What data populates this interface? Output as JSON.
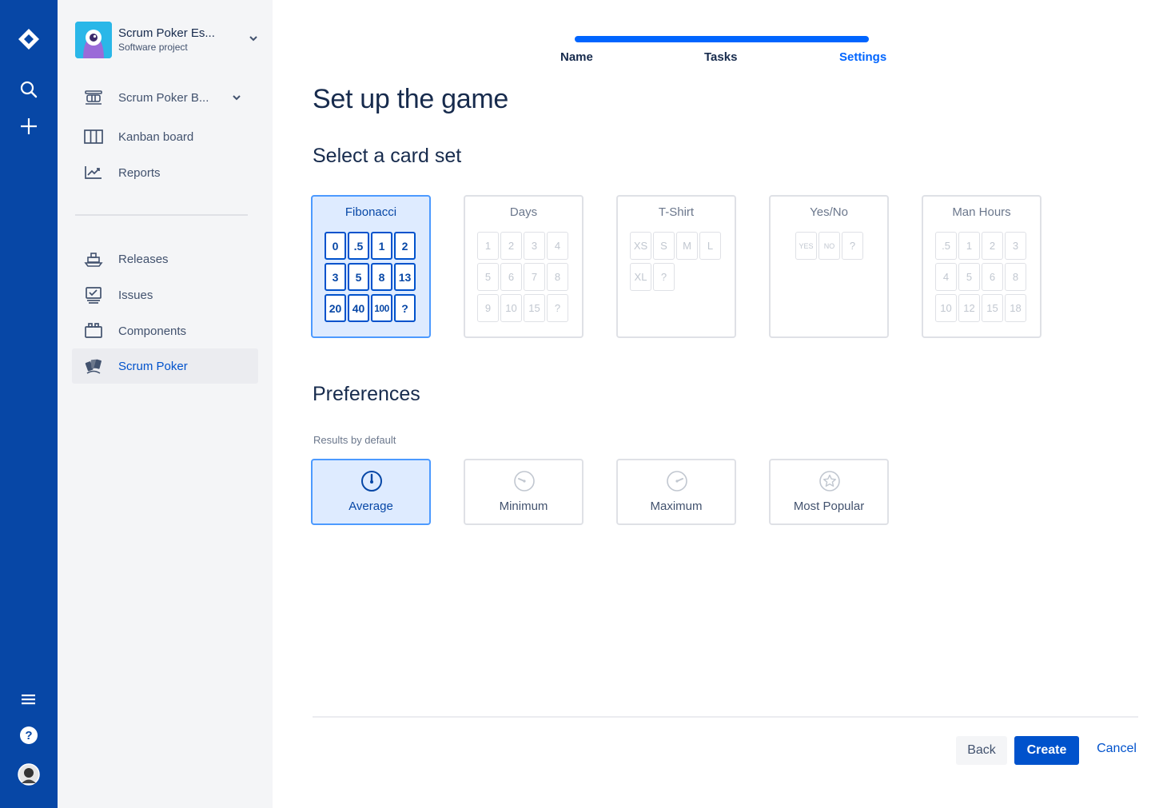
{
  "global_nav": {
    "icons": [
      "jira-logo-icon",
      "search-icon",
      "create-plus-icon",
      "menu-icon",
      "help-icon",
      "user-avatar"
    ],
    "brand_color": "#0747a6"
  },
  "project": {
    "name": "Scrum Poker Es...",
    "type": "Software project"
  },
  "sidebar": {
    "items": [
      {
        "label": "Scrum Poker B...",
        "icon": "board-icon"
      },
      {
        "label": "Kanban board",
        "icon": "kanban-icon"
      },
      {
        "label": "Reports",
        "icon": "reports-icon"
      },
      {
        "label": "Releases",
        "icon": "releases-icon"
      },
      {
        "label": "Issues",
        "icon": "issues-icon"
      },
      {
        "label": "Components",
        "icon": "components-icon"
      },
      {
        "label": "Scrum Poker",
        "icon": "scrum-poker-icon",
        "active": true
      }
    ]
  },
  "wizard": {
    "steps": [
      "Name",
      "Tasks",
      "Settings"
    ],
    "current_step": "Settings",
    "progress": 1.0
  },
  "page": {
    "title": "Set up the game",
    "card_set_heading": "Select a card set",
    "preferences_heading": "Preferences",
    "results_label": "Results by default"
  },
  "card_sets": [
    {
      "name": "Fibonacci",
      "selected": true,
      "cards": [
        "0",
        ".5",
        "1",
        "2",
        "3",
        "5",
        "8",
        "13",
        "20",
        "40",
        "100",
        "?"
      ]
    },
    {
      "name": "Days",
      "selected": false,
      "cards": [
        "1",
        "2",
        "3",
        "4",
        "5",
        "6",
        "7",
        "8",
        "9",
        "10",
        "15",
        "?"
      ]
    },
    {
      "name": "T-Shirt",
      "selected": false,
      "cards": [
        "XS",
        "S",
        "M",
        "L",
        "XL",
        "?"
      ]
    },
    {
      "name": "Yes/No",
      "selected": false,
      "cards": [
        "YES",
        "NO",
        "?"
      ]
    },
    {
      "name": "Man Hours",
      "selected": false,
      "cards": [
        ".5",
        "1",
        "2",
        "3",
        "4",
        "5",
        "6",
        "8",
        "10",
        "12",
        "15",
        "18"
      ]
    }
  ],
  "preferences": [
    {
      "label": "Average",
      "icon": "gauge-average-icon",
      "selected": true
    },
    {
      "label": "Minimum",
      "icon": "gauge-minimum-icon",
      "selected": false
    },
    {
      "label": "Maximum",
      "icon": "gauge-maximum-icon",
      "selected": false
    },
    {
      "label": "Most Popular",
      "icon": "star-icon",
      "selected": false
    }
  ],
  "actions": {
    "back": "Back",
    "create": "Create",
    "cancel": "Cancel"
  }
}
